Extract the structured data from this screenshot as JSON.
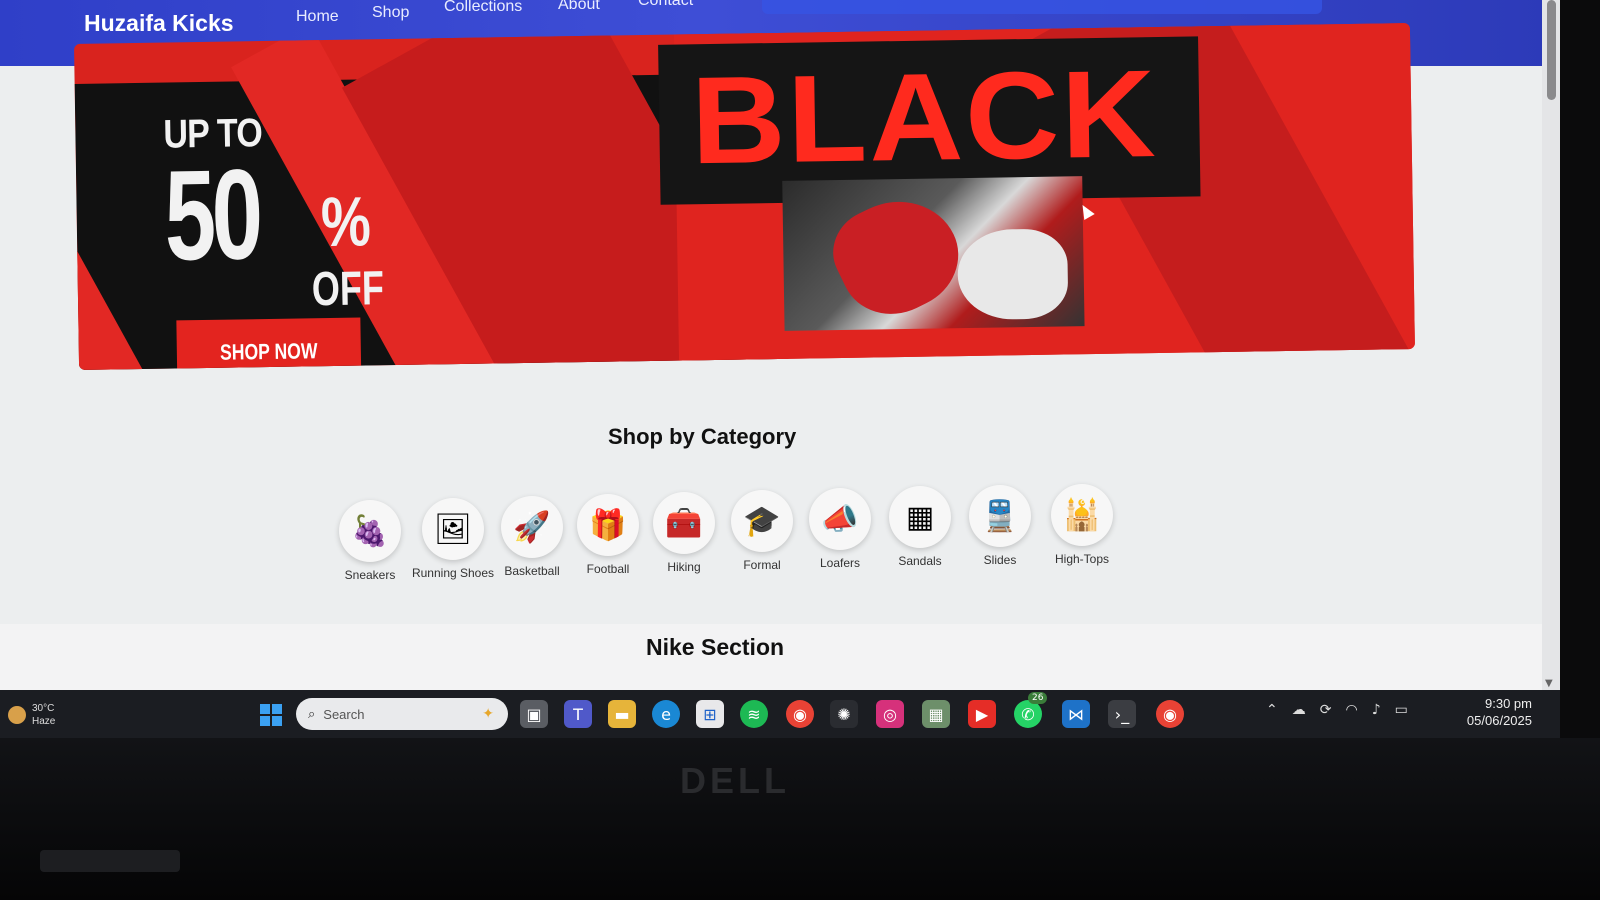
{
  "site": {
    "brand": "Huzaifa Kicks",
    "nav": [
      "Home",
      "Shop",
      "Collections",
      "About",
      "Contact"
    ]
  },
  "banner": {
    "upto": "UP TO",
    "percent": "50",
    "percent_sign": "%",
    "off": "OFF",
    "cta": "SHOP NOW",
    "headline": "BLACK",
    "colors": {
      "red": "#e22824",
      "dark": "#111111"
    }
  },
  "categories": {
    "title": "Shop by Category",
    "items": [
      {
        "label": "Sneakers",
        "icon": "grapes-icon",
        "glyph": "🍇"
      },
      {
        "label": "Running Shoes",
        "icon": "photo-cards-icon",
        "glyph": "🖼"
      },
      {
        "label": "Basketball",
        "icon": "rocket-icon",
        "glyph": "🚀"
      },
      {
        "label": "Football",
        "icon": "gifts-icon",
        "glyph": "🎁"
      },
      {
        "label": "Hiking",
        "icon": "toolbox-icon",
        "glyph": "🧰"
      },
      {
        "label": "Formal",
        "icon": "graduate-icon",
        "glyph": "🎓"
      },
      {
        "label": "Loafers",
        "icon": "megaphone-icon",
        "glyph": "📣"
      },
      {
        "label": "Sandals",
        "icon": "qr-code-icon",
        "glyph": "▦"
      },
      {
        "label": "Slides",
        "icon": "train-icon",
        "glyph": "🚆"
      },
      {
        "label": "High-Tops",
        "icon": "landmark-icon",
        "glyph": "🕌"
      }
    ]
  },
  "nike_section": {
    "title": "Nike Section"
  },
  "taskbar": {
    "weather_temp": "30°C",
    "weather_desc": "Haze",
    "search_placeholder": "Search",
    "whatsapp_badge": "26",
    "time": "9:30 pm",
    "date": "05/06/2025"
  },
  "bezel": {
    "logo": "DELL"
  }
}
